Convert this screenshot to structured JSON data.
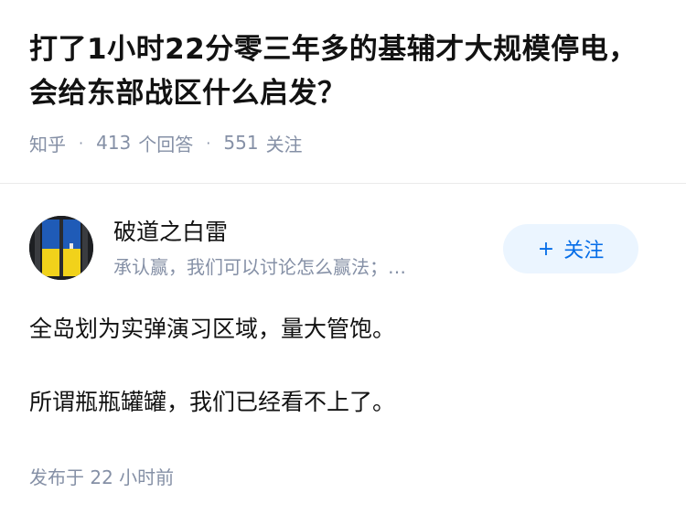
{
  "question": {
    "title": "打了1小时22分零三年多的基辅才大规模停电，会给东部战区什么启发？",
    "source": "知乎",
    "answer_count": "413",
    "answer_label": "个回答",
    "follower_count": "551",
    "follower_label": "关注"
  },
  "author": {
    "name": "破道之白雷",
    "bio": "承认赢，我们可以讨论怎么赢法；…",
    "follow_label": "关注",
    "avatar_colors": {
      "frame": "#1d1f22",
      "top": "#1f5bb7",
      "bottom": "#f1d21b"
    }
  },
  "answer": {
    "paragraphs": [
      "全岛划为实弹演习区域，量大管饱。",
      "所谓瓶瓶罐罐，我们已经看不上了。"
    ],
    "publish_time": "发布于  22 小时前"
  },
  "colors": {
    "text_primary": "#121212",
    "text_secondary": "#8590a6",
    "accent": "#056de8",
    "follow_bg": "#ebf5ff",
    "divider": "#ebebeb"
  }
}
